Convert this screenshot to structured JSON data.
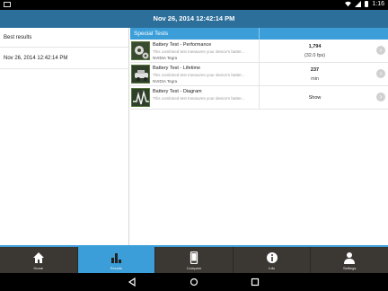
{
  "status_bar": {
    "time": "1:16"
  },
  "header": {
    "title": "Nov 26, 2014 12:42:14 PM"
  },
  "sidebar": {
    "items": [
      {
        "label": "Best results"
      },
      {
        "label": "Nov 26, 2014 12:42:14 PM"
      }
    ]
  },
  "main": {
    "section_title": "Special Tests",
    "rows": [
      {
        "title": "Battery Test - Performance",
        "description": "This combined test measures your device's batter...",
        "platform": "NVIDIA Tegra",
        "value": "1,794",
        "subvalue": "(32.0 fps)",
        "thumb_icon": "gears-icon"
      },
      {
        "title": "Battery Test - Lifetime",
        "description": "This combined test measures your device's batter...",
        "platform": "NVIDIA Tegra",
        "value": "237",
        "subvalue": "min",
        "thumb_icon": "car-icon"
      },
      {
        "title": "Battery Test - Diagram",
        "description": "This combined test measures your device's batter...",
        "value": "Show",
        "thumb_icon": "waveform-icon"
      }
    ]
  },
  "tabs": [
    {
      "label": "Home",
      "icon": "home-icon"
    },
    {
      "label": "Results",
      "icon": "bar-chart-icon",
      "active": true
    },
    {
      "label": "Compare",
      "icon": "phone-icon"
    },
    {
      "label": "Info",
      "icon": "info-icon"
    },
    {
      "label": "Settings",
      "icon": "person-icon"
    }
  ],
  "colors": {
    "header": "#2c6f9b",
    "accent": "#3b9ed9",
    "tabbar": "#3b3733"
  }
}
